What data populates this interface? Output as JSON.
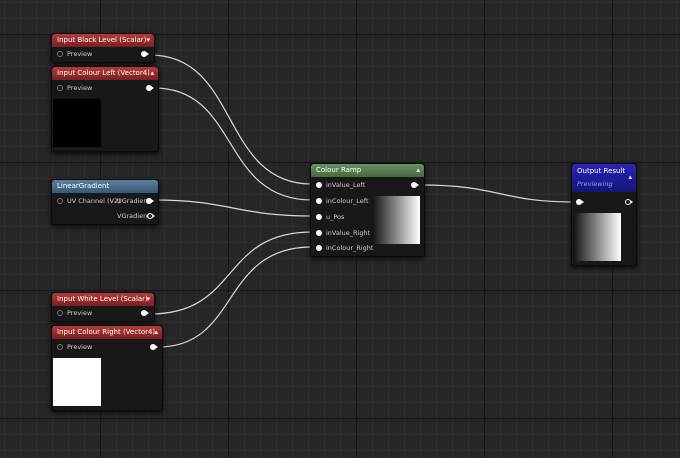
{
  "nodes": {
    "input_black": {
      "title": "Input Black Level (Scalar)",
      "preview_label": "Preview"
    },
    "input_colour_left": {
      "title": "Input Colour Left (Vector4)",
      "preview_label": "Preview"
    },
    "linear_gradient": {
      "title": "LinearGradient",
      "uv_label": "UV Channel (V2)",
      "ugradient_label": "UGradient",
      "vgradient_label": "VGradient"
    },
    "input_white": {
      "title": "Input White Level (Scalar)",
      "preview_label": "Preview"
    },
    "input_colour_right": {
      "title": "Input Colour Right (Vector4)",
      "preview_label": "Preview"
    },
    "colour_ramp": {
      "title": "Colour Ramp",
      "inputs": [
        "inValue_Left",
        "inColour_Left",
        "u_Pos",
        "inValue_Right",
        "inColour_Right"
      ]
    },
    "output_result": {
      "title": "Output Result",
      "status": "Previewing"
    }
  },
  "colors": {
    "wire": "#d9d9d9",
    "header_red": "#9a2c2c",
    "header_blue": "#4a6c88",
    "header_green": "#5a7c52",
    "header_output": "#1d1d99"
  }
}
